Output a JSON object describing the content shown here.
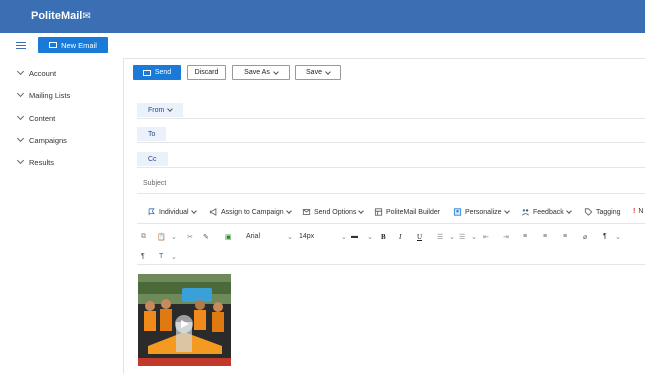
{
  "app": {
    "logo_text": "PoliteMail",
    "logo_mark": "✉"
  },
  "toolbar": {
    "new_email_label": "New Email"
  },
  "sidebar": {
    "items": [
      {
        "label": "Account"
      },
      {
        "label": "Mailing Lists"
      },
      {
        "label": "Content"
      },
      {
        "label": "Campaigns"
      },
      {
        "label": "Results"
      }
    ]
  },
  "compose": {
    "actions": {
      "send": "Send",
      "discard": "Discard",
      "save_as": "Save As",
      "save": "Save"
    },
    "fields": {
      "from": "From",
      "to": "To",
      "cc": "Cc",
      "subject_placeholder": "Subject"
    },
    "ribbon": {
      "individual": "Individual",
      "assign": "Assign to Campaign",
      "send_options": "Send Options",
      "builder": "PoliteMail Builder",
      "personalize": "Personalize",
      "feedback": "Feedback",
      "tagging": "Tagging",
      "priority_mark": "!",
      "priority_cut": "N"
    },
    "format": {
      "font": "Arial",
      "size": "14px",
      "bold": "B",
      "italic": "I",
      "underline": "U",
      "para": "¶"
    }
  },
  "colors": {
    "header": "#3a6fb3",
    "primary": "#1a7ad8",
    "field_label_bg": "#eaf1fb"
  }
}
